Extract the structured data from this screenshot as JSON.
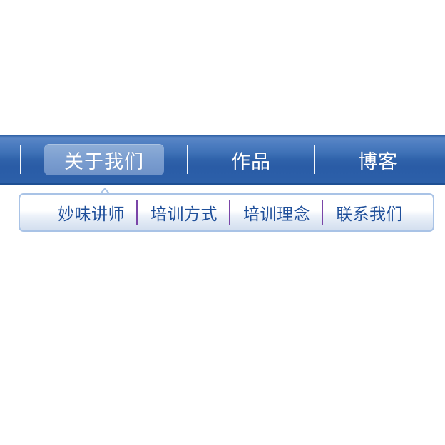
{
  "main_nav": {
    "items": [
      {
        "label": "关于我们",
        "active": true
      },
      {
        "label": "作品",
        "active": false
      },
      {
        "label": "博客",
        "active": false
      }
    ]
  },
  "sub_nav": {
    "items": [
      {
        "label": "妙味讲师"
      },
      {
        "label": "培训方式"
      },
      {
        "label": "培训理念"
      },
      {
        "label": "联系我们"
      }
    ]
  },
  "colors": {
    "nav_bar": "#2d5fa8",
    "nav_active_pill": "#7b9ed0",
    "nav_text": "#ffffff",
    "subnav_border": "#a9c3e6",
    "subnav_text": "#1f4f9a",
    "subnav_separator": "#7a45a8"
  }
}
